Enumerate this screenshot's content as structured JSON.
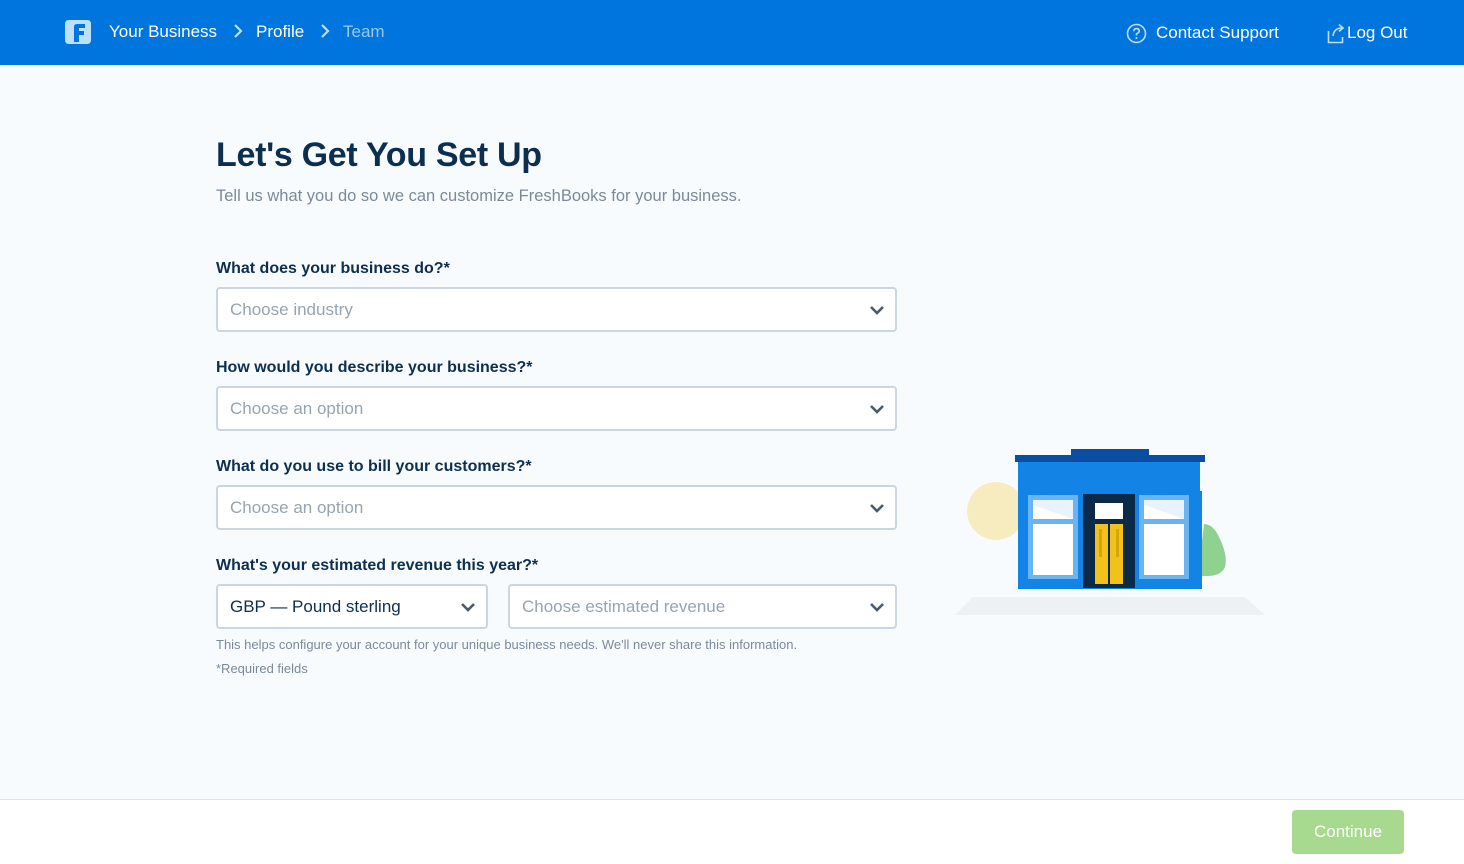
{
  "header": {
    "breadcrumbs": [
      "Your Business",
      "Profile",
      "Team"
    ],
    "contact_support": "Contact Support",
    "log_out": "Log Out"
  },
  "main": {
    "title": "Let's Get You Set Up",
    "subtitle": "Tell us what you do so we can customize FreshBooks for your business.",
    "questions": [
      {
        "label": "What does your business do?*",
        "placeholder": "Choose industry"
      },
      {
        "label": "How would you describe your business?*",
        "placeholder": "Choose an option"
      },
      {
        "label": "What do you use to bill your customers?*",
        "placeholder": "Choose an option"
      },
      {
        "label": "What's your estimated revenue this year?*",
        "currency_value": "GBP — Pound sterling",
        "revenue_placeholder": "Choose estimated revenue"
      }
    ],
    "help_text": "This helps configure your account for your unique business needs. We'll never share this information.",
    "required_note": "*Required fields"
  },
  "footer": {
    "continue_label": "Continue"
  },
  "colors": {
    "brand_blue": "#0075dd",
    "continue_green": "#a7d98f",
    "text_dark": "#0d2f4f"
  },
  "icons": [
    "freshbooks-logo-icon",
    "chevron-right-icon",
    "question-circle-icon",
    "logout-icon",
    "chevron-down-icon"
  ]
}
